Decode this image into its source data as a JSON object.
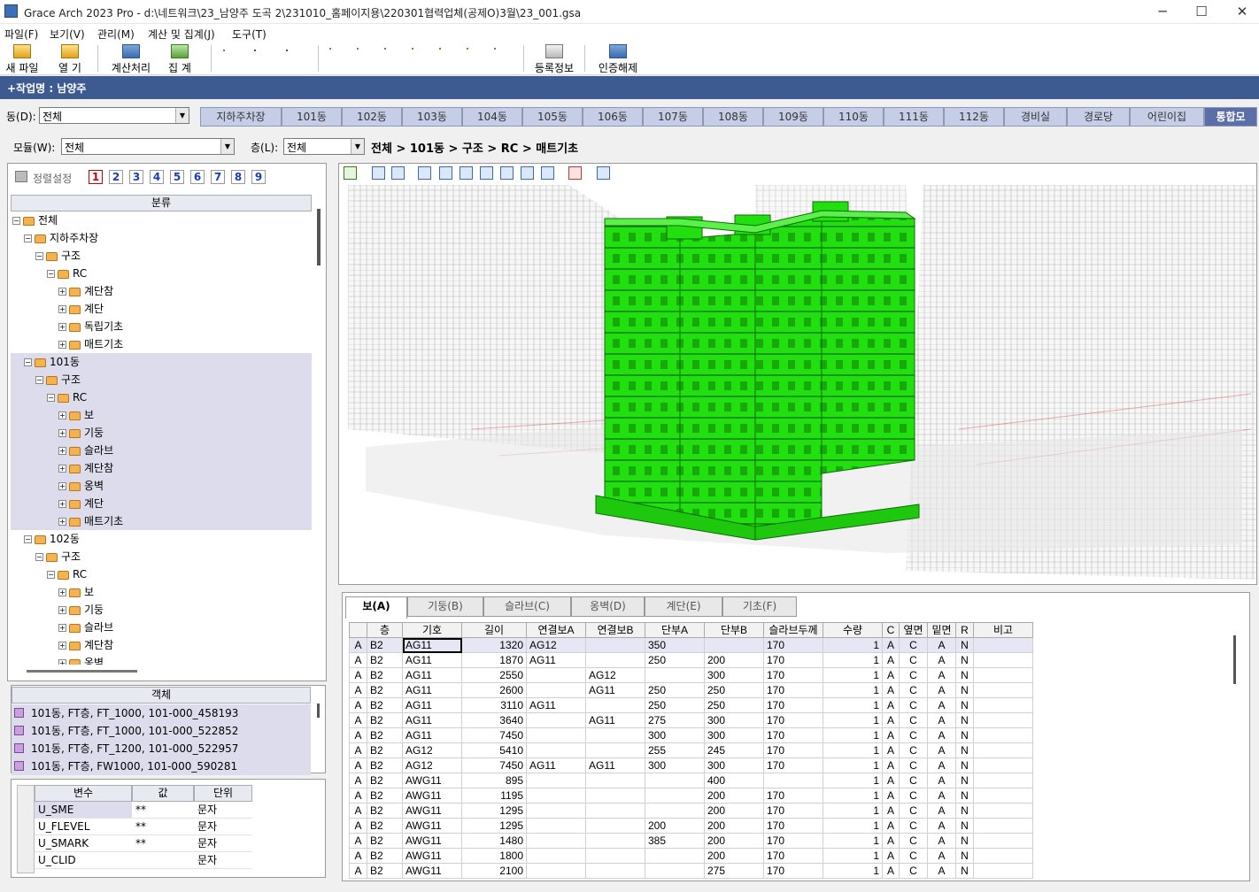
{
  "window": {
    "title": "Grace Arch 2023 Pro - d:\\네트워크\\23_남양주 도곡 2\\231010_홈페이지용\\220301협력업체(공제O)3월\\23_001.gsa",
    "controls": [
      "─",
      "☐",
      "✕"
    ]
  },
  "menu": [
    "파일(F)",
    "보기(V)",
    "관리(M)",
    "계산 및 집계(J)",
    "도구(T)"
  ],
  "toolbar": {
    "new": "새 파일",
    "open": "열  기",
    "calc": "계산처리",
    "sum": "집  계",
    "reg": "등록정보",
    "auth": "인증해제"
  },
  "job": {
    "label": "+작업명 : 남양주"
  },
  "dong": {
    "label": "동(D):",
    "value": "전체",
    "tabs": [
      "지하주차장",
      "101동",
      "102동",
      "103동",
      "104동",
      "105동",
      "106동",
      "107동",
      "108동",
      "109동",
      "110동",
      "111동",
      "112동",
      "경비실",
      "경로당",
      "어린이집",
      "통합모"
    ],
    "selected_tab": "통합모"
  },
  "filter": {
    "model_label": "모듈(W):",
    "model_value": "전체",
    "floor_label": "층(L):",
    "floor_value": "전체",
    "breadcrumb": "전체 > 101동 > 구조 > RC > 매트기초"
  },
  "sort": {
    "label": "정렬설정",
    "numbers": [
      "1",
      "2",
      "3",
      "4",
      "5",
      "6",
      "7",
      "8",
      "9"
    ],
    "active": "1"
  },
  "tree": {
    "header": "분류",
    "items": [
      {
        "label": "전체",
        "level": 0,
        "pm": "−"
      },
      {
        "label": "지하주차장",
        "level": 1,
        "pm": "−"
      },
      {
        "label": "구조",
        "level": 2,
        "pm": "−"
      },
      {
        "label": "RC",
        "level": 3,
        "pm": "−"
      },
      {
        "label": "계단참",
        "level": 4,
        "pm": "+"
      },
      {
        "label": "계단",
        "level": 4,
        "pm": "+"
      },
      {
        "label": "독립기초",
        "level": 4,
        "pm": "+"
      },
      {
        "label": "매트기초",
        "level": 4,
        "pm": "+"
      },
      {
        "label": "101동",
        "level": 1,
        "pm": "−",
        "hl": true
      },
      {
        "label": "구조",
        "level": 2,
        "pm": "−",
        "hl": true
      },
      {
        "label": "RC",
        "level": 3,
        "pm": "−",
        "hl": true
      },
      {
        "label": "보",
        "level": 4,
        "pm": "+",
        "hl": true
      },
      {
        "label": "기둥",
        "level": 4,
        "pm": "+",
        "hl": true
      },
      {
        "label": "슬라브",
        "level": 4,
        "pm": "+",
        "hl": true
      },
      {
        "label": "계단참",
        "level": 4,
        "pm": "+",
        "hl": true
      },
      {
        "label": "옹벽",
        "level": 4,
        "pm": "+",
        "hl": true
      },
      {
        "label": "계단",
        "level": 4,
        "pm": "+",
        "hl": true
      },
      {
        "label": "매트기초",
        "level": 4,
        "pm": "+",
        "hl": true
      },
      {
        "label": "102동",
        "level": 1,
        "pm": "−"
      },
      {
        "label": "구조",
        "level": 2,
        "pm": "−"
      },
      {
        "label": "RC",
        "level": 3,
        "pm": "−"
      },
      {
        "label": "보",
        "level": 4,
        "pm": "+"
      },
      {
        "label": "기둥",
        "level": 4,
        "pm": "+"
      },
      {
        "label": "슬라브",
        "level": 4,
        "pm": "+"
      },
      {
        "label": "계단참",
        "level": 4,
        "pm": "+"
      },
      {
        "label": "옹벽",
        "level": 4,
        "pm": "+"
      }
    ]
  },
  "objects": {
    "header": "객체",
    "items": [
      "101동, FT층, FT_1000, 101-000_458193",
      "101동, FT층, FT_1000, 101-000_522852",
      "101동, FT층, FT_1200, 101-000_522957",
      "101동, FT층, FW1000, 101-000_590281"
    ]
  },
  "vars": {
    "headers": [
      "변수",
      "값",
      "단위"
    ],
    "rows": [
      [
        "U_SME",
        "**",
        "문자"
      ],
      [
        "U_FLEVEL",
        "**",
        "문자"
      ],
      [
        "U_SMARK",
        "**",
        "문자"
      ],
      [
        "U_CLID",
        "",
        "문자"
      ]
    ]
  },
  "gridtabs": [
    "보(A)",
    "기둥(B)",
    "슬라브(C)",
    "옹벽(D)",
    "계단(E)",
    "기초(F)"
  ],
  "grid": {
    "headers": [
      "",
      "층",
      "기호",
      "길이",
      "연결보A",
      "연결보B",
      "단부A",
      "단부B",
      "슬라브두께",
      "수량",
      "C",
      "옆면",
      "밑면",
      "R",
      "비고"
    ],
    "rows": [
      [
        "A",
        "B2",
        "AG11",
        "1320",
        "AG12",
        "",
        "350",
        "",
        "170",
        "1",
        "A",
        "C",
        "A",
        "N",
        ""
      ],
      [
        "A",
        "B2",
        "AG11",
        "1870",
        "AG11",
        "",
        "250",
        "200",
        "170",
        "1",
        "A",
        "C",
        "A",
        "N",
        ""
      ],
      [
        "A",
        "B2",
        "AG11",
        "2550",
        "",
        "AG12",
        "",
        "300",
        "170",
        "1",
        "A",
        "C",
        "A",
        "N",
        ""
      ],
      [
        "A",
        "B2",
        "AG11",
        "2600",
        "",
        "AG11",
        "250",
        "250",
        "170",
        "1",
        "A",
        "C",
        "A",
        "N",
        ""
      ],
      [
        "A",
        "B2",
        "AG11",
        "3110",
        "AG11",
        "",
        "250",
        "250",
        "170",
        "1",
        "A",
        "C",
        "A",
        "N",
        ""
      ],
      [
        "A",
        "B2",
        "AG11",
        "3640",
        "",
        "AG11",
        "275",
        "300",
        "170",
        "1",
        "A",
        "C",
        "A",
        "N",
        ""
      ],
      [
        "A",
        "B2",
        "AG11",
        "7450",
        "",
        "",
        "300",
        "300",
        "170",
        "1",
        "A",
        "C",
        "A",
        "N",
        ""
      ],
      [
        "A",
        "B2",
        "AG12",
        "5410",
        "",
        "",
        "255",
        "245",
        "170",
        "1",
        "A",
        "C",
        "A",
        "N",
        ""
      ],
      [
        "A",
        "B2",
        "AG12",
        "7450",
        "AG11",
        "AG11",
        "300",
        "300",
        "170",
        "1",
        "A",
        "C",
        "A",
        "N",
        ""
      ],
      [
        "A",
        "B2",
        "AWG11",
        "895",
        "",
        "",
        "",
        "400",
        "",
        "1",
        "A",
        "C",
        "A",
        "N",
        ""
      ],
      [
        "A",
        "B2",
        "AWG11",
        "1195",
        "",
        "",
        "",
        "200",
        "170",
        "1",
        "A",
        "C",
        "A",
        "N",
        ""
      ],
      [
        "A",
        "B2",
        "AWG11",
        "1295",
        "",
        "",
        "",
        "200",
        "170",
        "1",
        "A",
        "C",
        "A",
        "N",
        ""
      ],
      [
        "A",
        "B2",
        "AWG11",
        "1295",
        "",
        "",
        "200",
        "200",
        "170",
        "1",
        "A",
        "C",
        "A",
        "N",
        ""
      ],
      [
        "A",
        "B2",
        "AWG11",
        "1480",
        "",
        "",
        "385",
        "200",
        "170",
        "1",
        "A",
        "C",
        "A",
        "N",
        ""
      ],
      [
        "A",
        "B2",
        "AWG11",
        "1800",
        "",
        "",
        "",
        "200",
        "170",
        "1",
        "A",
        "C",
        "A",
        "N",
        ""
      ],
      [
        "A",
        "B2",
        "AWG11",
        "2100",
        "",
        "",
        "",
        "275",
        "170",
        "1",
        "A",
        "C",
        "A",
        "N",
        ""
      ]
    ]
  },
  "colors": {
    "accent": "#3d5a91",
    "building": "#22e00f",
    "tab": "#c6cde6",
    "selection": "#dcdced"
  }
}
